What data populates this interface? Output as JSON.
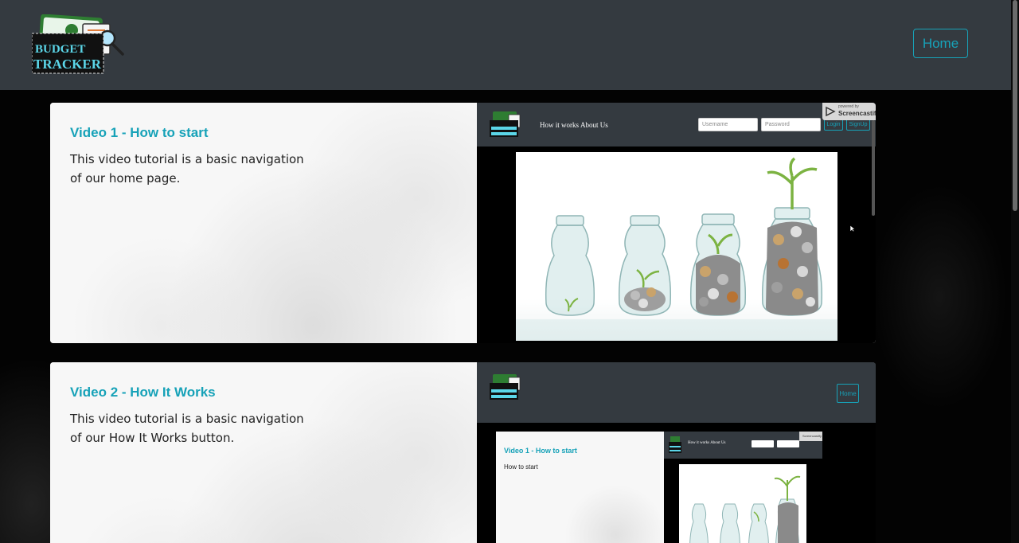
{
  "navbar": {
    "logo_text_top": "BUDGET",
    "logo_text_bottom": "TRACKER",
    "home_label": "Home"
  },
  "videos": [
    {
      "title": "Video 1 - How to start",
      "description": "This video tutorial is a basic navigation of our home page.",
      "preview": {
        "nav_links": [
          "How it works",
          "About Us"
        ],
        "username_placeholder": "Username",
        "password_placeholder": "Password",
        "login_label": "Login",
        "signup_label": "SignUp",
        "watermark_small": "powered by",
        "watermark_brand": "Screencastify"
      }
    },
    {
      "title": "Video 2 - How It Works",
      "description": "This video tutorial is a basic navigation of our How It Works button.",
      "preview": {
        "home_label": "Home",
        "nested_title": "Video 1 - How to start",
        "nested_desc": "How to start",
        "nested_nav_links": "How it works  About Us",
        "nested_watermark": "Screencastify"
      }
    }
  ],
  "colors": {
    "accent": "#17a2b8",
    "navbar_bg": "#343a40",
    "page_bg": "#050505"
  }
}
